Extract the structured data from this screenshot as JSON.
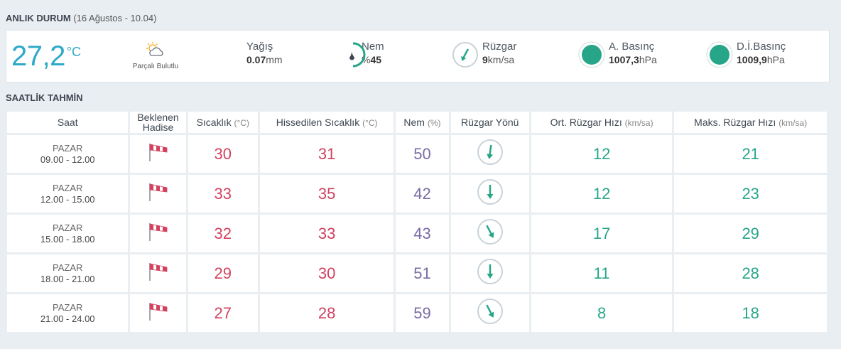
{
  "current": {
    "section_title": "ANLIK DURUM",
    "section_sub": "(16 Ağustos - 10.04)",
    "temp": "27,2",
    "temp_unit": "°C",
    "condition": "Parçalı Bulutlu",
    "rain_label": "Yağış",
    "rain_value": "0.07",
    "rain_unit": "mm",
    "humidity_label": "Nem",
    "humidity_prefix": "%",
    "humidity_value": "45",
    "humidity_level": 0.45,
    "wind_label": "Rüzgar",
    "wind_value": "9",
    "wind_unit": "km/sa",
    "pressure_label": "A. Basınç",
    "pressure_value": "1007,3",
    "pressure_unit": "hPa",
    "dpressure_label": "D.İ.Basınç",
    "dpressure_value": "1009,9",
    "dpressure_unit": "hPa",
    "colors": {
      "accent": "#2fa9c9",
      "green": "#27a589",
      "red": "#d2425f",
      "purple": "#7a6ba6"
    }
  },
  "hourly": {
    "section_title": "SAATLİK TAHMİN",
    "headers": {
      "time": "Saat",
      "event_line1": "Beklenen",
      "event_line2": "Hadise",
      "temp": "Sıcaklık",
      "temp_unit": "(°C)",
      "feels": "Hissedilen Sıcaklık",
      "feels_unit": "(°C)",
      "hum": "Nem",
      "hum_unit": "(%)",
      "wind_dir": "Rüzgar Yönü",
      "avg_wind": "Ort. Rüzgar Hızı",
      "avg_wind_unit": "(km/sa)",
      "max_wind": "Maks. Rüzgar Hızı",
      "max_wind_unit": "(km/sa)"
    },
    "rows": [
      {
        "day": "PAZAR",
        "time": "09.00 - 12.00",
        "event_icon": "windsock-icon",
        "temp": "30",
        "feels": "31",
        "hum": "50",
        "wind_dir_icon": "arrow-icon",
        "avg_wind": "12",
        "max_wind": "21"
      },
      {
        "day": "PAZAR",
        "time": "12.00 - 15.00",
        "event_icon": "windsock-icon",
        "temp": "33",
        "feels": "35",
        "hum": "42",
        "wind_dir_icon": "arrow-icon",
        "avg_wind": "12",
        "max_wind": "23"
      },
      {
        "day": "PAZAR",
        "time": "15.00 - 18.00",
        "event_icon": "windsock-icon",
        "temp": "32",
        "feels": "33",
        "hum": "43",
        "wind_dir_icon": "arrow-icon",
        "avg_wind": "17",
        "max_wind": "29"
      },
      {
        "day": "PAZAR",
        "time": "18.00 - 21.00",
        "event_icon": "windsock-icon",
        "temp": "29",
        "feels": "30",
        "hum": "51",
        "wind_dir_icon": "arrow-icon",
        "avg_wind": "11",
        "max_wind": "28"
      },
      {
        "day": "PAZAR",
        "time": "21.00 - 24.00",
        "event_icon": "windsock-icon",
        "temp": "27",
        "feels": "28",
        "hum": "59",
        "wind_dir_icon": "arrow-icon",
        "avg_wind": "8",
        "max_wind": "18"
      }
    ]
  }
}
